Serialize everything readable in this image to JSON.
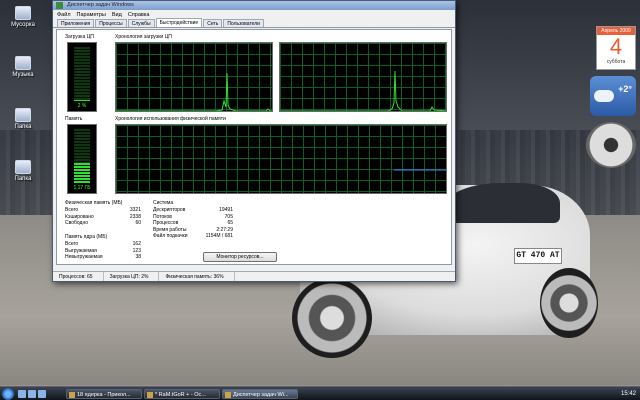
{
  "window": {
    "title": "Диспетчер задач Windows",
    "menu": [
      "Файл",
      "Параметры",
      "Вид",
      "Справка"
    ],
    "tabs": [
      "Приложения",
      "Процессы",
      "Службы",
      "Быстродействие",
      "Сеть",
      "Пользователи"
    ],
    "active_tab": "Быстродействие"
  },
  "performance": {
    "cpu_usage_label": "Загрузка ЦП",
    "cpu_usage_value": "2 %",
    "cpu_usage_fraction": 0.02,
    "cpu_history_label": "Хронология загрузки ЦП",
    "memory_label": "Память",
    "memory_value": "1,17 ГБ",
    "memory_fraction": 0.36,
    "memory_history_label": "Хронология использования физической памяти"
  },
  "physical_memory": {
    "heading": "Физическая память (МБ)",
    "rows": [
      {
        "label": "Всего",
        "value": "3321"
      },
      {
        "label": "Кэшировано",
        "value": "2338"
      },
      {
        "label": "Свободно",
        "value": "60"
      }
    ]
  },
  "kernel_memory": {
    "heading": "Память ядра (МБ)",
    "rows": [
      {
        "label": "Всего",
        "value": "162"
      },
      {
        "label": "Выгружаемая",
        "value": "123"
      },
      {
        "label": "Невыгружаемая",
        "value": "38"
      }
    ]
  },
  "system": {
    "heading": "Система",
    "rows": [
      {
        "label": "Дескрипторов",
        "value": "19491"
      },
      {
        "label": "Потоков",
        "value": "705"
      },
      {
        "label": "Процессов",
        "value": "65"
      },
      {
        "label": "Время работы",
        "value": "2:27:29"
      },
      {
        "label": "Файл подкачки",
        "value": "1154M / 681"
      }
    ]
  },
  "monitor_button": "Монитор ресурсов...",
  "statusbar": {
    "processes": "Процессов: 65",
    "cpu": "Загрузка ЦП: 2%",
    "memory": "Физическая память: 36%"
  },
  "desktop_icons": [
    "Мусорка",
    "Музыка",
    "Папка",
    "Папка"
  ],
  "gadgets": {
    "calendar_month": "Апрель 2009",
    "calendar_day": "4",
    "calendar_weekday": "суббота",
    "weather_temp": "+2°"
  },
  "car_plate": "GT 470 AT",
  "taskbar": {
    "buttons": [
      "18 ядерка - Прикол...",
      "* RaM.tGoR + - Ос...",
      "Диспетчер задач Wi..."
    ],
    "clock": "15:42"
  },
  "colors": {
    "graph_line": "#2fe12f",
    "memory_line": "#3a8cff",
    "grid": "#0b5d2a"
  }
}
